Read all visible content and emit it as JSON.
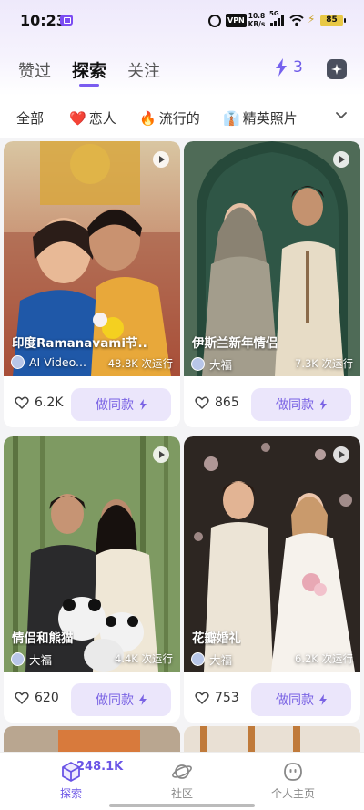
{
  "status_bar": {
    "time": "10:23",
    "vpn": "VPN",
    "net_speed_value": "10.8",
    "net_speed_unit": "KB/s",
    "signal": "5G",
    "battery": "85"
  },
  "header": {
    "tabs": [
      {
        "label": "赞过",
        "active": false
      },
      {
        "label": "探索",
        "active": true
      },
      {
        "label": "关注",
        "active": false
      }
    ],
    "energy_count": "3"
  },
  "categories": [
    {
      "label": "全部",
      "emoji": ""
    },
    {
      "label": "恋人",
      "emoji": "❤️"
    },
    {
      "label": "流行的",
      "emoji": "🔥"
    },
    {
      "label": "精英照片",
      "emoji": "👔"
    }
  ],
  "cards": [
    {
      "title": "印度Ramanavami节...",
      "author": "AI Video...",
      "runs": "48.8K 次运行",
      "likes": "6.2K",
      "action": "做同款"
    },
    {
      "title": "伊斯兰新年情侣",
      "author": "大福",
      "runs": "7.3K 次运行",
      "likes": "865",
      "action": "做同款"
    },
    {
      "title": "情侣和熊猫",
      "author": "大福",
      "runs": "4.4K 次运行",
      "likes": "620",
      "action": "做同款"
    },
    {
      "title": "花瓣婚礼",
      "author": "大福",
      "runs": "6.2K 次运行",
      "likes": "753",
      "action": "做同款"
    }
  ],
  "bottom_nav": {
    "badge": "248.1K",
    "items": [
      {
        "label": "探索",
        "active": true,
        "icon": "explore-icon"
      },
      {
        "label": "社区",
        "active": false,
        "icon": "planet-icon"
      },
      {
        "label": "个人主页",
        "active": false,
        "icon": "profile-icon"
      }
    ]
  },
  "colors": {
    "accent": "#7a5cf0",
    "button_bg": "#ebe6fb"
  }
}
